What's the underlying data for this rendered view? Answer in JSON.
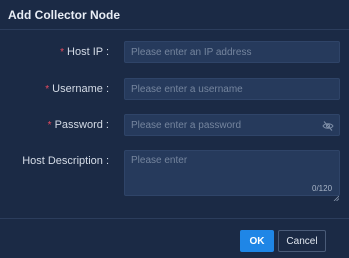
{
  "dialog": {
    "title": "Add Collector Node"
  },
  "form": {
    "host_ip": {
      "label": "Host IP :",
      "required_mark": "*",
      "placeholder": "Please enter an IP address",
      "value": ""
    },
    "username": {
      "label": "Username :",
      "required_mark": "*",
      "placeholder": "Please enter a username",
      "value": ""
    },
    "password": {
      "label": "Password :",
      "required_mark": "*",
      "placeholder": "Please enter a password",
      "value": "",
      "visibility_icon": "eye-off-icon"
    },
    "host_description": {
      "label": "Host Description :",
      "placeholder": "Please enter",
      "value": "",
      "counter": "0/120"
    }
  },
  "footer": {
    "ok_label": "OK",
    "cancel_label": "Cancel"
  },
  "colors": {
    "background": "#1b2a45",
    "input_background": "#263a5c",
    "accent": "#1f86e6",
    "required": "#e84a5f"
  }
}
